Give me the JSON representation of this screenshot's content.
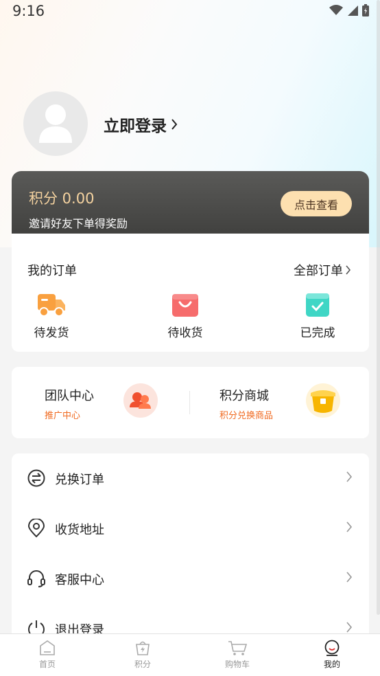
{
  "status_bar": {
    "time": "9:16",
    "icons": [
      "wifi-icon",
      "signal-icon",
      "battery-icon"
    ]
  },
  "profile": {
    "login_label": "立即登录",
    "avatar_icon": "user-avatar-icon"
  },
  "points_card": {
    "points_text": "积分 0.00",
    "invite_text": "邀请好友下单得奖励",
    "view_button": "点击查看",
    "accent": "#f5d3a0"
  },
  "orders": {
    "title": "我的订单",
    "all_label": "全部订单",
    "items": [
      {
        "label": "待发货",
        "icon": "truck-icon",
        "color": "#f9a03f"
      },
      {
        "label": "待收货",
        "icon": "shopping-bag-icon",
        "color": "#f66c6c"
      },
      {
        "label": "已完成",
        "icon": "check-box-icon",
        "color": "#3fd6c5"
      }
    ]
  },
  "promos": [
    {
      "title": "团队中心",
      "subtitle": "推广中心",
      "icon": "team-icon"
    },
    {
      "title": "积分商城",
      "subtitle": "积分兑换商品",
      "icon": "treasure-pot-icon"
    }
  ],
  "menu": [
    {
      "label": "兑换订单",
      "icon": "exchange-icon"
    },
    {
      "label": "收货地址",
      "icon": "location-pin-icon"
    },
    {
      "label": "客服中心",
      "icon": "headset-icon"
    },
    {
      "label": "退出登录",
      "icon": "power-icon"
    }
  ],
  "tabbar": [
    {
      "label": "首页",
      "icon": "home-icon",
      "active": false
    },
    {
      "label": "积分",
      "icon": "points-bag-icon",
      "active": false
    },
    {
      "label": "购物车",
      "icon": "cart-icon",
      "active": false
    },
    {
      "label": "我的",
      "icon": "profile-face-icon",
      "active": true
    }
  ]
}
